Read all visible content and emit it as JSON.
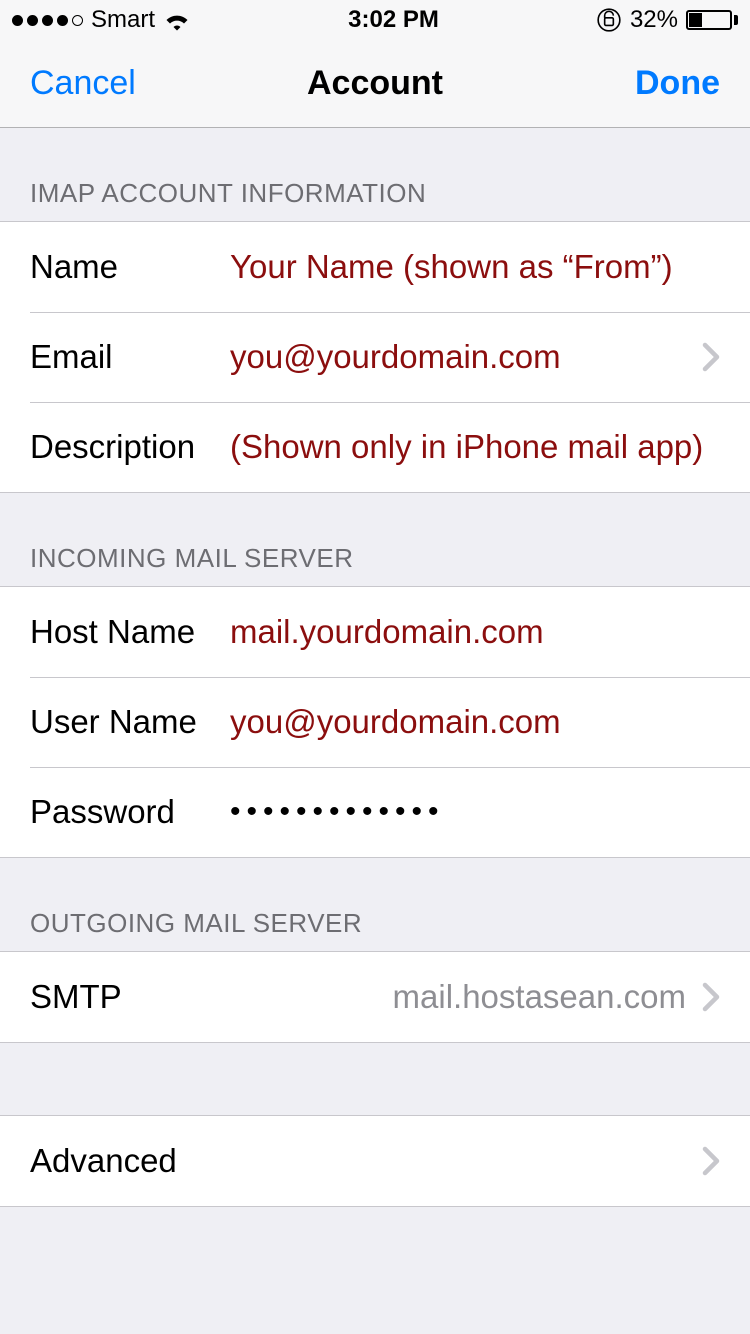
{
  "status": {
    "carrier": "Smart",
    "time": "3:02 PM",
    "battery_pct": "32%"
  },
  "nav": {
    "left": "Cancel",
    "title": "Account",
    "right": "Done"
  },
  "sections": {
    "imap": {
      "header": "IMAP ACCOUNT INFORMATION",
      "name_label": "Name",
      "name_value": "Your Name (shown as “From”)",
      "email_label": "Email",
      "email_value": "you@yourdomain.com",
      "desc_label": "Description",
      "desc_value": "(Shown only in iPhone mail app)"
    },
    "incoming": {
      "header": "INCOMING MAIL SERVER",
      "host_label": "Host Name",
      "host_value": "mail.yourdomain.com",
      "user_label": "User Name",
      "user_value": "you@yourdomain.com",
      "pass_label": "Password",
      "pass_value": "•••••••••••••"
    },
    "outgoing": {
      "header": "OUTGOING MAIL SERVER",
      "smtp_label": "SMTP",
      "smtp_value": "mail.hostasean.com"
    },
    "advanced": {
      "label": "Advanced"
    }
  },
  "colors": {
    "accent_blue": "#007aff",
    "value_red": "#8b0e0e",
    "section_grey": "#6d6d72",
    "detail_grey": "#8e8e93"
  }
}
